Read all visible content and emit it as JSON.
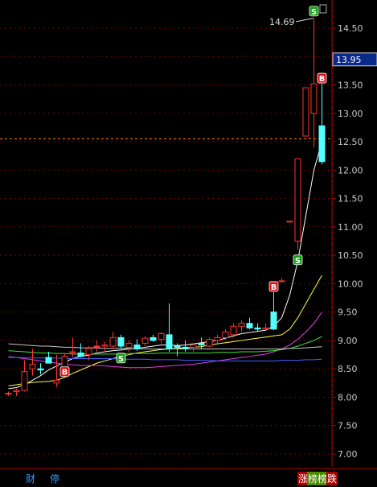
{
  "chart_data": {
    "type": "candlestick",
    "y_ticks": [
      "14.50",
      "14.00",
      "13.50",
      "13.00",
      "12.50",
      "12.00",
      "11.50",
      "11.00",
      "10.50",
      "10.00",
      "9.50",
      "9.00",
      "8.50",
      "8.00",
      "7.50",
      "7.00"
    ],
    "ylim": [
      6.82,
      15.0
    ],
    "current_price": "13.95",
    "reference_price": 12.55,
    "max_annotation": "14.69",
    "candles": [
      {
        "o": 8.06,
        "h": 8.1,
        "l": 8.02,
        "c": 8.07
      },
      {
        "o": 8.1,
        "h": 8.15,
        "l": 8.02,
        "c": 8.12
      },
      {
        "o": 8.12,
        "h": 8.65,
        "l": 8.1,
        "c": 8.45
      },
      {
        "o": 8.5,
        "h": 8.85,
        "l": 8.38,
        "c": 8.58
      },
      {
        "o": 8.5,
        "h": 8.6,
        "l": 8.4,
        "c": 8.48
      },
      {
        "o": 8.7,
        "h": 8.8,
        "l": 8.6,
        "c": 8.6
      },
      {
        "o": 8.25,
        "h": 8.75,
        "l": 8.18,
        "c": 8.3
      },
      {
        "o": 8.45,
        "h": 8.78,
        "l": 8.4,
        "c": 8.72
      },
      {
        "o": 8.8,
        "h": 9.05,
        "l": 8.7,
        "c": 8.8
      },
      {
        "o": 8.78,
        "h": 8.95,
        "l": 8.7,
        "c": 8.72
      },
      {
        "o": 8.75,
        "h": 8.9,
        "l": 8.65,
        "c": 8.86
      },
      {
        "o": 8.9,
        "h": 9.0,
        "l": 8.8,
        "c": 8.9
      },
      {
        "o": 8.9,
        "h": 8.98,
        "l": 8.8,
        "c": 8.92
      },
      {
        "o": 8.9,
        "h": 9.15,
        "l": 8.85,
        "c": 9.05
      },
      {
        "o": 9.05,
        "h": 9.1,
        "l": 8.85,
        "c": 8.9
      },
      {
        "o": 8.88,
        "h": 9.0,
        "l": 8.8,
        "c": 8.95
      },
      {
        "o": 8.92,
        "h": 9.02,
        "l": 8.82,
        "c": 8.85
      },
      {
        "o": 8.95,
        "h": 9.08,
        "l": 8.9,
        "c": 9.04
      },
      {
        "o": 9.05,
        "h": 9.1,
        "l": 8.98,
        "c": 9.0
      },
      {
        "o": 9.02,
        "h": 9.15,
        "l": 8.95,
        "c": 9.12
      },
      {
        "o": 9.1,
        "h": 9.65,
        "l": 8.8,
        "c": 8.85
      },
      {
        "o": 8.9,
        "h": 8.95,
        "l": 8.72,
        "c": 8.88
      },
      {
        "o": 8.88,
        "h": 9.0,
        "l": 8.8,
        "c": 8.85
      },
      {
        "o": 8.88,
        "h": 8.95,
        "l": 8.8,
        "c": 8.92
      },
      {
        "o": 8.95,
        "h": 9.05,
        "l": 8.85,
        "c": 8.92
      },
      {
        "o": 8.9,
        "h": 9.05,
        "l": 8.88,
        "c": 9.02
      },
      {
        "o": 9.0,
        "h": 9.1,
        "l": 8.95,
        "c": 9.05
      },
      {
        "o": 9.05,
        "h": 9.2,
        "l": 9.0,
        "c": 9.15
      },
      {
        "o": 9.1,
        "h": 9.3,
        "l": 9.05,
        "c": 9.25
      },
      {
        "o": 9.25,
        "h": 9.35,
        "l": 9.15,
        "c": 9.3
      },
      {
        "o": 9.3,
        "h": 9.4,
        "l": 9.2,
        "c": 9.22
      },
      {
        "o": 9.22,
        "h": 9.3,
        "l": 9.15,
        "c": 9.2
      },
      {
        "o": 9.2,
        "h": 9.3,
        "l": 9.18,
        "c": 9.22
      },
      {
        "o": 9.5,
        "h": 9.85,
        "l": 9.18,
        "c": 9.2
      },
      {
        "o": 10.05,
        "h": 10.1,
        "l": 10.05,
        "c": 10.05
      },
      {
        "o": 11.1,
        "h": 11.1,
        "l": 11.1,
        "c": 11.1
      },
      {
        "o": 10.75,
        "h": 12.2,
        "l": 10.6,
        "c": 12.2
      },
      {
        "o": 12.6,
        "h": 13.45,
        "l": 12.6,
        "c": 13.45
      },
      {
        "o": 13.0,
        "h": 14.69,
        "l": 12.4,
        "c": 13.52
      },
      {
        "o": 12.78,
        "h": 13.52,
        "l": 12.1,
        "c": 12.15
      }
    ],
    "ma_lines": [
      {
        "color": "#ffffff",
        "values": [
          8.15,
          8.17,
          8.22,
          8.3,
          8.38,
          8.48,
          8.55,
          8.62,
          8.68,
          8.72,
          8.74,
          8.78,
          8.8,
          8.82,
          8.83,
          8.85,
          8.86,
          8.88,
          8.9,
          8.92,
          8.92,
          8.91,
          8.92,
          8.94,
          8.96,
          8.98,
          9.0,
          9.04,
          9.08,
          9.12,
          9.14,
          9.16,
          9.18,
          9.25,
          9.4,
          9.8,
          10.4,
          11.2,
          12.0,
          12.5
        ]
      },
      {
        "color": "#ffff40",
        "values": [
          8.2,
          8.22,
          8.24,
          8.26,
          8.27,
          8.28,
          8.3,
          8.35,
          8.42,
          8.48,
          8.54,
          8.6,
          8.64,
          8.68,
          8.72,
          8.75,
          8.78,
          8.8,
          8.82,
          8.84,
          8.85,
          8.86,
          8.87,
          8.88,
          8.89,
          8.92,
          8.94,
          8.96,
          8.98,
          9.0,
          9.02,
          9.04,
          9.06,
          9.08,
          9.1,
          9.2,
          9.4,
          9.65,
          9.9,
          10.15
        ]
      },
      {
        "color": "#e040e0",
        "values": [
          8.72,
          8.7,
          8.68,
          8.66,
          8.64,
          8.62,
          8.6,
          8.58,
          8.57,
          8.56,
          8.56,
          8.56,
          8.55,
          8.54,
          8.53,
          8.52,
          8.52,
          8.52,
          8.53,
          8.54,
          8.55,
          8.56,
          8.57,
          8.58,
          8.6,
          8.62,
          8.64,
          8.66,
          8.68,
          8.7,
          8.72,
          8.74,
          8.76,
          8.8,
          8.85,
          8.92,
          9.02,
          9.15,
          9.3,
          9.5
        ]
      },
      {
        "color": "#40e040",
        "values": [
          8.82,
          8.81,
          8.8,
          8.79,
          8.78,
          8.78,
          8.77,
          8.77,
          8.76,
          8.76,
          8.76,
          8.76,
          8.76,
          8.76,
          8.76,
          8.77,
          8.77,
          8.77,
          8.77,
          8.78,
          8.78,
          8.78,
          8.78,
          8.78,
          8.78,
          8.78,
          8.79,
          8.79,
          8.79,
          8.8,
          8.8,
          8.8,
          8.81,
          8.82,
          8.84,
          8.86,
          8.9,
          8.95,
          9.0,
          9.07
        ]
      },
      {
        "color": "#c8c8c8",
        "values": [
          8.94,
          8.93,
          8.92,
          8.91,
          8.9,
          8.9,
          8.89,
          8.88,
          8.88,
          8.87,
          8.87,
          8.87,
          8.86,
          8.86,
          8.86,
          8.86,
          8.85,
          8.85,
          8.85,
          8.85,
          8.85,
          8.85,
          8.85,
          8.85,
          8.85,
          8.85,
          8.85,
          8.85,
          8.85,
          8.85,
          8.85,
          8.85,
          8.85,
          8.85,
          8.85,
          8.86,
          8.86,
          8.87,
          8.88,
          8.89
        ]
      },
      {
        "color": "#4060ff",
        "values": [
          8.7,
          8.7,
          8.7,
          8.69,
          8.69,
          8.69,
          8.69,
          8.68,
          8.68,
          8.68,
          8.68,
          8.68,
          8.68,
          8.68,
          8.67,
          8.67,
          8.67,
          8.67,
          8.66,
          8.66,
          8.66,
          8.66,
          8.65,
          8.65,
          8.65,
          8.65,
          8.64,
          8.64,
          8.64,
          8.64,
          8.64,
          8.64,
          8.64,
          8.64,
          8.65,
          8.65,
          8.65,
          8.66,
          8.66,
          8.67
        ]
      }
    ],
    "signals": [
      {
        "label": "B",
        "idx": 7,
        "price": 8.45,
        "color": "#e01010"
      },
      {
        "label": "S",
        "idx": 14,
        "price": 8.69,
        "color": "#11a011"
      },
      {
        "label": "B",
        "idx": 33,
        "price": 9.95,
        "color": "#e01010"
      },
      {
        "label": "S",
        "idx": 36,
        "price": 10.42,
        "color": "#11a011"
      },
      {
        "label": "B",
        "idx": 39,
        "price": 13.62,
        "color": "#e01010"
      },
      {
        "label": "S",
        "idx": 38,
        "price": 14.8,
        "color": "#11a011"
      }
    ],
    "colors": {
      "up": "#ff3030",
      "down": "#54ffff",
      "background": "#000000",
      "axis": "#b00000",
      "refline": "#ff8000"
    }
  },
  "bottom_left": [
    {
      "name": "finance-tag-button",
      "label": "财",
      "x": 32
    },
    {
      "name": "suspend-tag-button",
      "label": "停",
      "x": 62
    }
  ],
  "bottom_right": [
    {
      "name": "limit-up-tag-button",
      "label": "涨",
      "color": "#b00000",
      "x": 370
    },
    {
      "name": "dragon-tiger-tag-button",
      "label": "榜",
      "color": "#4a8a00",
      "x": 382
    },
    {
      "name": "ranking-tag-button",
      "label": "榜",
      "color": "#4a8a00",
      "x": 394
    },
    {
      "name": "limit-down-tag-button",
      "label": "跌",
      "color": "#b00000",
      "x": 406
    }
  ]
}
